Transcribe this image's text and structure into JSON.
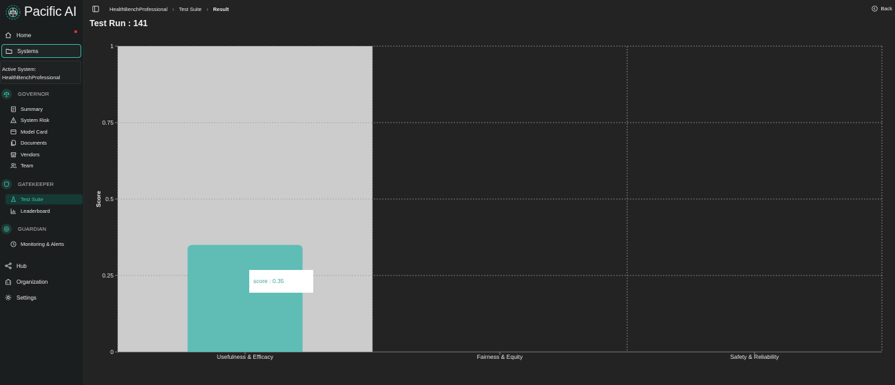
{
  "app": {
    "name": "Pacific AI"
  },
  "sidebar": {
    "home": "Home",
    "systems": "Systems",
    "active_system_label": "Active System:",
    "active_system_value": "HealthBenchProfessional",
    "governor": {
      "title": "GOVERNOR",
      "items": [
        "Summary",
        "System Risk",
        "Model Card",
        "Documents",
        "Vendors",
        "Team"
      ]
    },
    "gatekeeper": {
      "title": "GATEKEEPER",
      "items": [
        "Test Suite",
        "Leaderboard"
      ]
    },
    "guardian": {
      "title": "GUARDIAN",
      "items": [
        "Monitoring & Alerts"
      ]
    },
    "hub": "Hub",
    "organization": "Organization",
    "settings": "Settings"
  },
  "header": {
    "breadcrumb": [
      "HealthBenchProfessional",
      "Test Suite",
      "Result"
    ],
    "back_label": "Back",
    "title": "Test Run : 141"
  },
  "colors": {
    "accent": "#3fc2ad",
    "bar": "#5fbdb6",
    "highlight": "#cccccc"
  },
  "chart_data": {
    "type": "bar",
    "categories": [
      "Usefulness & Efficacy",
      "Fairness & Equity",
      "Safety & Reliability"
    ],
    "series": [
      {
        "values": [
          0.35,
          0,
          0
        ]
      }
    ],
    "ylabel": "Score",
    "ylim": [
      0,
      1
    ],
    "yticks": [
      "0",
      "0.25",
      "0.5",
      "0.75",
      "1"
    ],
    "grid": true,
    "hovered_category": 0,
    "tooltip": "score : 0.35"
  }
}
